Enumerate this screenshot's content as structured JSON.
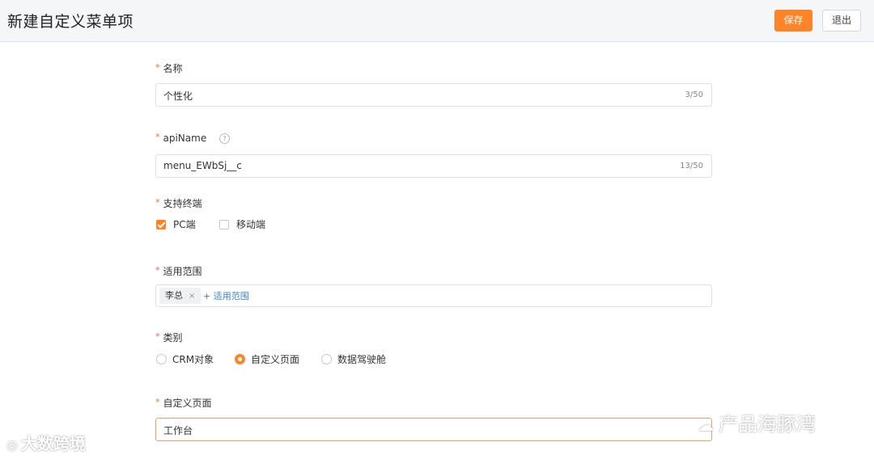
{
  "header": {
    "title": "新建自定义菜单项",
    "save_label": "保存",
    "exit_label": "退出"
  },
  "form": {
    "required_mark": "*",
    "name": {
      "label": "名称",
      "value": "个性化",
      "count": "3/50"
    },
    "api_name": {
      "label": "apiName",
      "help": "?",
      "value": "menu_EWbSj__c",
      "count": "13/50"
    },
    "terminal": {
      "label": "支持终端",
      "options": [
        {
          "label": "PC端",
          "checked": true
        },
        {
          "label": "移动端",
          "checked": false
        }
      ]
    },
    "scope": {
      "label": "适用范围",
      "tags": [
        {
          "label": "李总",
          "remove": "×"
        }
      ],
      "add_label": "+ 适用范围"
    },
    "category": {
      "label": "类别",
      "options": [
        {
          "label": "CRM对象",
          "selected": false
        },
        {
          "label": "自定义页面",
          "selected": true
        },
        {
          "label": "数据驾驶舱",
          "selected": false
        }
      ]
    },
    "custom_page": {
      "label": "自定义页面",
      "value": "工作台"
    }
  },
  "watermarks": {
    "left": "大数跨境",
    "right": "产品海豚湾"
  },
  "colors": {
    "accent": "#ff8427",
    "link": "#3a80e6",
    "required": "#f26b3a"
  }
}
